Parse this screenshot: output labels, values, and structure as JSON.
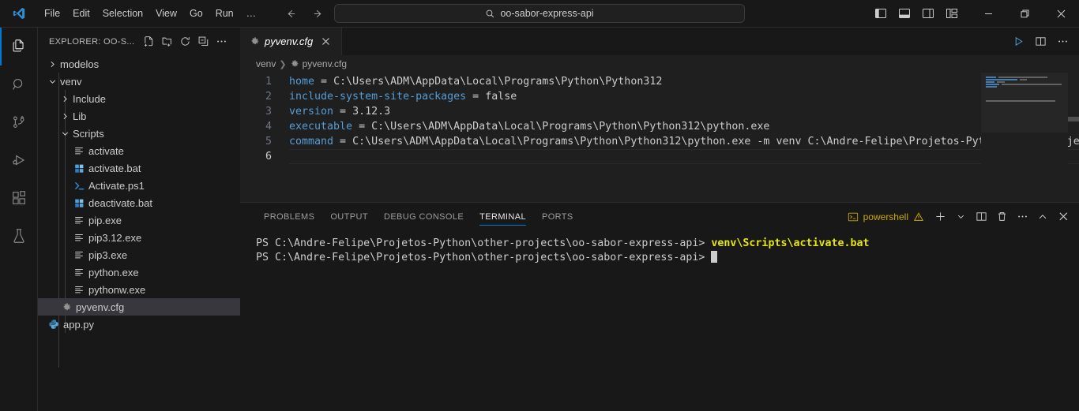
{
  "titlebar": {
    "logo": "vscode-logo",
    "menu": [
      "File",
      "Edit",
      "Selection",
      "View",
      "Go",
      "Run",
      "…"
    ],
    "nav": {
      "back": "back-arrow-icon",
      "forward": "forward-arrow-icon"
    },
    "search": {
      "value": "oo-sabor-express-api",
      "icon": "search-icon"
    },
    "layout": [
      "toggle-primary-sidebar-icon",
      "toggle-panel-icon",
      "toggle-secondary-sidebar-icon",
      "customize-layout-icon"
    ],
    "window": {
      "minimize": "─",
      "maximize": "restore-icon",
      "close": "✕"
    }
  },
  "activitybar": {
    "items": [
      {
        "name": "explorer",
        "icon": "files-icon",
        "active": true
      },
      {
        "name": "search",
        "icon": "search-icon",
        "active": false
      },
      {
        "name": "source-control",
        "icon": "source-control-icon",
        "active": false
      },
      {
        "name": "run-and-debug",
        "icon": "run-debug-icon",
        "active": false
      },
      {
        "name": "extensions",
        "icon": "extensions-icon",
        "active": false
      },
      {
        "name": "testing",
        "icon": "beaker-icon",
        "active": false
      }
    ]
  },
  "sidebar": {
    "title": "EXPLORER: OO-S...",
    "actions": [
      "new-file-icon",
      "new-folder-icon",
      "refresh-icon",
      "collapse-all-icon",
      "more-actions-icon"
    ],
    "tree": [
      {
        "label": "modelos",
        "kind": "folder",
        "expanded": false,
        "depth": 0,
        "icon": "chevron-right-icon"
      },
      {
        "label": "venv",
        "kind": "folder",
        "expanded": true,
        "depth": 0,
        "icon": "chevron-down-icon"
      },
      {
        "label": "Include",
        "kind": "folder",
        "expanded": false,
        "depth": 1,
        "icon": "chevron-right-icon"
      },
      {
        "label": "Lib",
        "kind": "folder",
        "expanded": false,
        "depth": 1,
        "icon": "chevron-right-icon"
      },
      {
        "label": "Scripts",
        "kind": "folder",
        "expanded": true,
        "depth": 1,
        "icon": "chevron-down-icon"
      },
      {
        "label": "activate",
        "kind": "file",
        "depth": 2,
        "icon": "text-file-icon"
      },
      {
        "label": "activate.bat",
        "kind": "file",
        "depth": 2,
        "icon": "windows-bat-icon"
      },
      {
        "label": "Activate.ps1",
        "kind": "file",
        "depth": 2,
        "icon": "powershell-icon"
      },
      {
        "label": "deactivate.bat",
        "kind": "file",
        "depth": 2,
        "icon": "windows-bat-icon"
      },
      {
        "label": "pip.exe",
        "kind": "file",
        "depth": 2,
        "icon": "text-file-icon"
      },
      {
        "label": "pip3.12.exe",
        "kind": "file",
        "depth": 2,
        "icon": "text-file-icon"
      },
      {
        "label": "pip3.exe",
        "kind": "file",
        "depth": 2,
        "icon": "text-file-icon"
      },
      {
        "label": "python.exe",
        "kind": "file",
        "depth": 2,
        "icon": "text-file-icon"
      },
      {
        "label": "pythonw.exe",
        "kind": "file",
        "depth": 2,
        "icon": "text-file-icon"
      },
      {
        "label": "pyvenv.cfg",
        "kind": "file",
        "depth": 1,
        "icon": "gear-icon",
        "selected": true
      },
      {
        "label": "app.py",
        "kind": "file",
        "depth": 0,
        "icon": "python-icon"
      }
    ]
  },
  "editor": {
    "tab": {
      "label": "pyvenv.cfg",
      "icon": "gear-icon",
      "close": "✕",
      "dirty": false
    },
    "actions": [
      "run-python-file-icon",
      "split-editor-icon",
      "more-actions-icon"
    ],
    "breadcrumb": [
      {
        "label": "venv",
        "icon": null
      },
      {
        "label": "pyvenv.cfg",
        "icon": "gear-icon"
      }
    ],
    "lines": [
      {
        "n": 1,
        "key": "home",
        "eq": " = ",
        "value": "C:\\Users\\ADM\\AppData\\Local\\Programs\\Python\\Python312"
      },
      {
        "n": 2,
        "key": "include-system-site-packages",
        "eq": " = ",
        "value": "false"
      },
      {
        "n": 3,
        "key": "version",
        "eq": " = ",
        "value": "3.12.3"
      },
      {
        "n": 4,
        "key": "executable",
        "eq": " = ",
        "value": "C:\\Users\\ADM\\AppData\\Local\\Programs\\Python\\Python312\\python.exe"
      },
      {
        "n": 5,
        "key": "command",
        "eq": " = ",
        "value": "C:\\Users\\ADM\\AppData\\Local\\Programs\\Python\\Python312\\python.exe -m venv C:\\Andre-Felipe\\Projetos-Python\\other-projects\\oo-sabor-express-api\\venv"
      },
      {
        "n": 6,
        "key": "",
        "eq": "",
        "value": ""
      }
    ]
  },
  "panel": {
    "tabs": [
      {
        "label": "PROBLEMS",
        "active": false
      },
      {
        "label": "OUTPUT",
        "active": false
      },
      {
        "label": "DEBUG CONSOLE",
        "active": false
      },
      {
        "label": "TERMINAL",
        "active": true
      },
      {
        "label": "PORTS",
        "active": false
      }
    ],
    "terminal_chip": {
      "icon": "terminal-powershell-icon",
      "label": "powershell",
      "warning": "warning-triangle-icon"
    },
    "actions": [
      "new-terminal-icon",
      "terminal-dropdown-icon",
      "split-terminal-icon",
      "kill-terminal-icon",
      "more-actions-icon",
      "maximize-panel-icon",
      "close-panel-icon"
    ],
    "terminal_lines": [
      {
        "prompt": "PS C:\\Andre-Felipe\\Projetos-Python\\other-projects\\oo-sabor-express-api> ",
        "command": "venv\\Scripts\\activate.bat",
        "cursor": false
      },
      {
        "prompt": "PS C:\\Andre-Felipe\\Projetos-Python\\other-projects\\oo-sabor-express-api> ",
        "command": "",
        "cursor": true
      }
    ]
  },
  "colors": {
    "accent": "#0078d4",
    "editor_bg": "#1f1f1f",
    "chrome_bg": "#181818",
    "key": "#569cd6",
    "terminal_command": "#e5e510",
    "terminal_chip": "#cca700",
    "selection": "#37373d"
  }
}
